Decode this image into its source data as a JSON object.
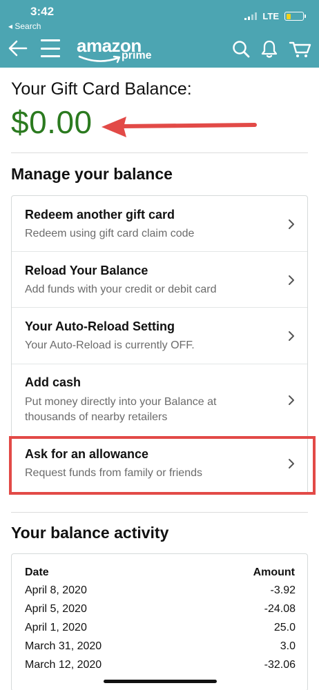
{
  "status_bar": {
    "time": "3:42",
    "back_label": "◂ Search",
    "network": "LTE",
    "battery_level": 0.28
  },
  "header": {
    "logo_word": "amazon",
    "logo_sub": "prime",
    "background": "#4ca5b2",
    "icons": [
      "back-arrow-icon",
      "menu-icon",
      "search-icon",
      "bell-icon",
      "cart-icon"
    ]
  },
  "balance": {
    "title": "Your Gift Card Balance:",
    "amount": "$0.00",
    "amount_color": "#2b7a1f",
    "annotation_color": "#e24a47"
  },
  "manage": {
    "title": "Manage your balance",
    "items": [
      {
        "title": "Redeem another gift card",
        "subtitle": "Redeem using gift card claim code"
      },
      {
        "title": "Reload Your Balance",
        "subtitle": "Add funds with your credit or debit card"
      },
      {
        "title": "Your Auto-Reload Setting",
        "subtitle": "Your Auto-Reload is currently OFF."
      },
      {
        "title": "Add cash",
        "subtitle": "Put money directly into your Balance at thousands of nearby retailers"
      },
      {
        "title": "Ask for an allowance",
        "subtitle": "Request funds from family or friends"
      }
    ]
  },
  "activity": {
    "title": "Your balance activity",
    "columns": [
      "Date",
      "Amount"
    ],
    "rows": [
      {
        "date": "April 8, 2020",
        "amount": "-3.92"
      },
      {
        "date": "April 5, 2020",
        "amount": "-24.08"
      },
      {
        "date": "April 1, 2020",
        "amount": "25.0"
      },
      {
        "date": "March 31, 2020",
        "amount": "3.0"
      },
      {
        "date": "March 12, 2020",
        "amount": "-32.06"
      }
    ]
  }
}
